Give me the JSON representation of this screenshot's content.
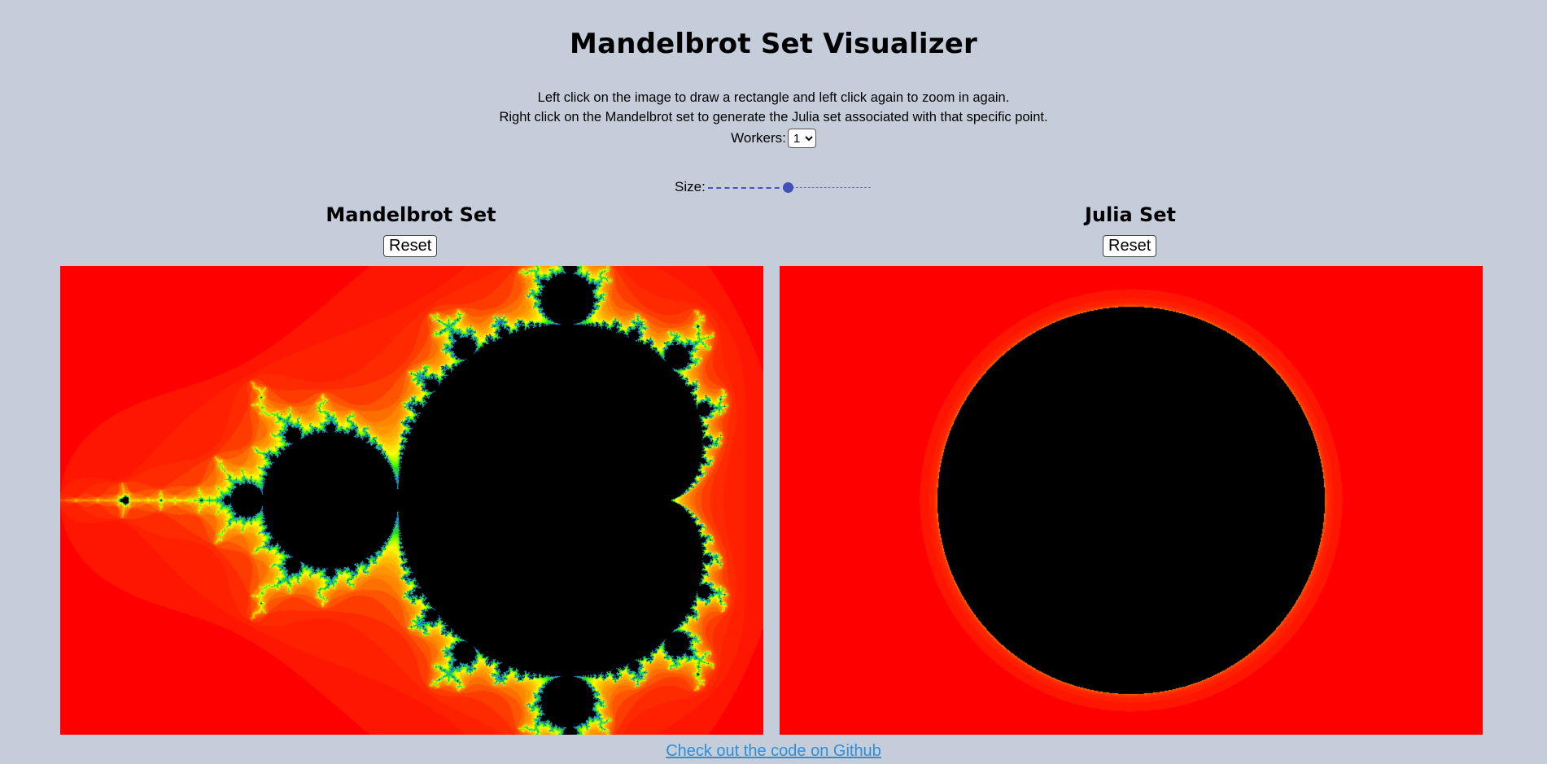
{
  "page": {
    "title": "Mandelbrot Set Visualizer",
    "instructions": [
      "Left click on the image to draw a rectangle and left click again to zoom in again.",
      "Right click on the Mandelbrot set to generate the Julia set associated with that specific point."
    ],
    "workers_label": "Workers:",
    "workers_selected": "1",
    "size_label": "Size:",
    "size_value": 0.49
  },
  "mandelbrot": {
    "title": "Mandelbrot Set",
    "reset_label": "Reset"
  },
  "julia": {
    "title": "Julia Set",
    "reset_label": "Reset"
  },
  "footer": {
    "link_text": "Check out the code on Github"
  },
  "colors": {
    "background": "#c5cdda",
    "set_interior": "#000000",
    "escape_outer": "#ff0000",
    "escape_edge_yellow": "#ffff00",
    "escape_edge_green": "#00c800",
    "link": "#2e8ed6",
    "slider": "#4350b5"
  }
}
